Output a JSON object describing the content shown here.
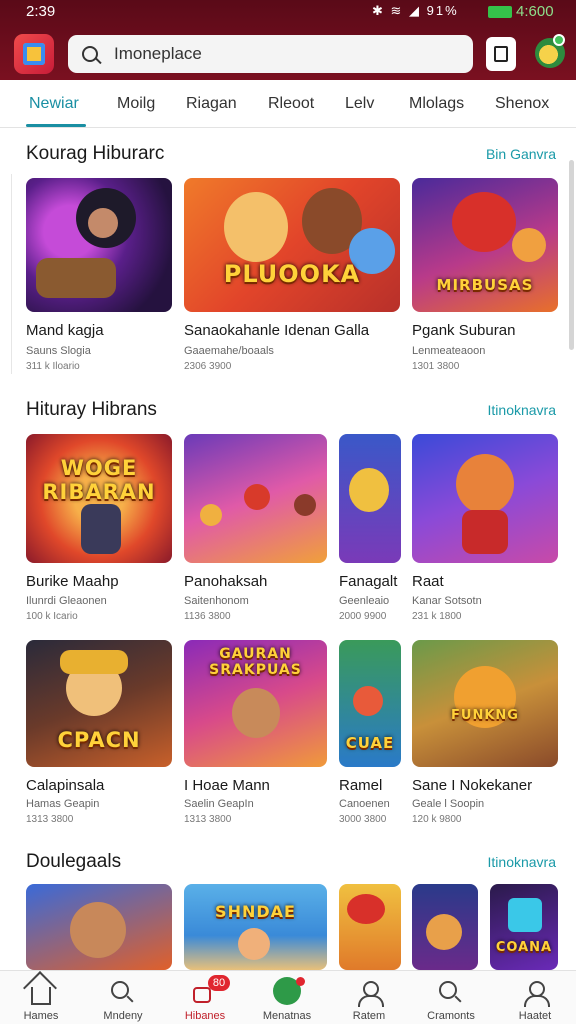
{
  "status_bar": {
    "time": "2:39",
    "icons": "✱ ≋ ◢ 91%",
    "clock_right": "4:600"
  },
  "header": {
    "search_text": "Imoneplace"
  },
  "tabs": [
    {
      "label": "Newiar",
      "active": true
    },
    {
      "label": "Moilg"
    },
    {
      "label": "Riagan"
    },
    {
      "label": "Rleoot"
    },
    {
      "label": "Lelv"
    },
    {
      "label": "Mlolags"
    },
    {
      "label": "Shenox"
    }
  ],
  "sections": [
    {
      "title": "Kourag Hiburarc",
      "link": "Bin Ganvra",
      "cards": [
        {
          "title": "Mand kagja",
          "sub": "Sauns Slogia",
          "meta": "311 k Iloario",
          "art_text": ""
        },
        {
          "title": "Sanaokahanle Idenan Galla",
          "sub": "Gaaemahe/boaals",
          "meta": "2306 3900",
          "art_text": "PLUOOKA"
        },
        {
          "title": "Pgank Suburan",
          "sub": "Lenmeateaoon",
          "meta": "1301 3800",
          "art_text": "MIRBUSAS"
        }
      ]
    },
    {
      "title": "Hituray Hibrans",
      "link": "Itinoknavra",
      "cards": [
        {
          "title": "Burike Maahp",
          "sub": "Ilunrdi Gleaonen",
          "meta": "100 k Icario",
          "art_text": "WOGE RIBARAN"
        },
        {
          "title": "Panohaksah",
          "sub": "Saitenhonom",
          "meta": "1136 3800",
          "art_text": ""
        },
        {
          "title": "Fanagalt",
          "sub": "Geenleaio",
          "meta": "2000 9900",
          "art_text": ""
        },
        {
          "title": "Raat",
          "sub": "Kanar Sotsotn",
          "meta": "231 k 1800",
          "art_text": ""
        },
        {
          "title": "Calapinsala",
          "sub": "Hamas Geapin",
          "meta": "1313 3800",
          "art_text": "CPACN"
        },
        {
          "title": "I Hoae Mann",
          "sub": "Saelin GeapIn",
          "meta": "1313 3800",
          "art_text": "GAURAN SRAKPUAS"
        },
        {
          "title": "Ramel",
          "sub": "Canoenen",
          "meta": "3000 3800",
          "art_text": "CUAE"
        },
        {
          "title": "Sane I Nokekaner",
          "sub": "Geale l Soopin",
          "meta": "120 k 9800",
          "art_text": "FUNKNG"
        }
      ]
    },
    {
      "title": "Doulegaals",
      "link": "Itinoknavra",
      "cards": [
        {
          "title": "",
          "sub": "",
          "meta": "",
          "art_text": ""
        },
        {
          "title": "",
          "sub": "",
          "meta": "",
          "art_text": "SHNDAE"
        },
        {
          "title": "",
          "sub": "",
          "meta": "",
          "art_text": ""
        },
        {
          "title": "",
          "sub": "",
          "meta": "",
          "art_text": ""
        },
        {
          "title": "",
          "sub": "",
          "meta": "",
          "art_text": "COANA"
        }
      ]
    }
  ],
  "bottom_nav": [
    {
      "label": "Hames",
      "icon": "home-icon"
    },
    {
      "label": "Mndeny",
      "icon": "search-icon"
    },
    {
      "label": "Hibanes",
      "icon": "inbox-icon",
      "badge": "80",
      "active": true
    },
    {
      "label": "Menatnas",
      "icon": "games-icon",
      "dot": true
    },
    {
      "label": "Ratem",
      "icon": "user-icon"
    },
    {
      "label": "Cramonts",
      "icon": "search-icon"
    },
    {
      "label": "Haatet",
      "icon": "user-icon"
    }
  ],
  "colors": {
    "header_bg": "#6a0e1c",
    "accent": "#1a8fa3",
    "badge": "#e0262f"
  }
}
